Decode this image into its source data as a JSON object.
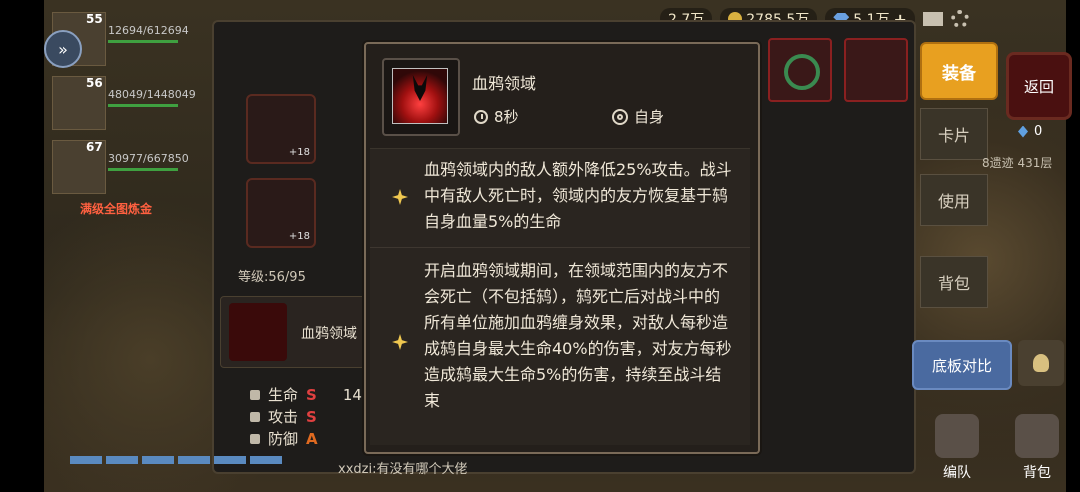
{
  "topbar": {
    "res1": "2.7万",
    "res2": "2785.5万",
    "res3": "5.1万",
    "plus": "+"
  },
  "team": [
    {
      "level": "55",
      "hp": "12694/612694"
    },
    {
      "level": "56",
      "hp": "48049/1448049"
    },
    {
      "level": "67",
      "hp": "30977/667850"
    }
  ],
  "team_label": "满级全图炼金",
  "panel": {
    "level_text": "等级:56/95",
    "item_plus": "+18",
    "skill_name": "血鸦领域",
    "stats": [
      {
        "label": "生命",
        "grade": "S",
        "value": "14"
      },
      {
        "label": "攻击",
        "grade": "S",
        "value": ""
      },
      {
        "label": "防御",
        "grade": "A",
        "value": ""
      }
    ]
  },
  "right": {
    "equip": "装备",
    "return": "返回",
    "card": "卡片",
    "use": "使用",
    "bag_tab": "背包",
    "shard_count": "0",
    "floor": "8遗迹 431层",
    "compare": "底板对比",
    "team_btn": "编队",
    "bag_btn": "背包"
  },
  "chat": "xxdzi:有没有哪个大佬",
  "tooltip": {
    "title": "血鸦领域",
    "time": "8秒",
    "target": "自身",
    "desc1": "血鸦领域内的敌人额外降低25%攻击。战斗中有敌人死亡时，领域内的友方恢复基于鸫自身血量5%的生命",
    "desc2": "开启血鸦领域期间，在领域范围内的友方不会死亡（不包括鸫），鸫死亡后对战斗中的所有单位施加血鸦缠身效果，对敌人每秒造成鸫自身最大生命40%的伤害，对友方每秒造成鸫最大生命5%的伤害，持续至战斗结束"
  }
}
